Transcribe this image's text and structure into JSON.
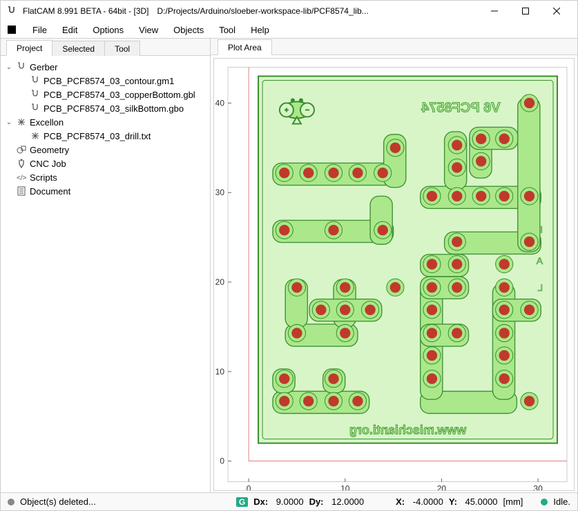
{
  "title": "FlatCAM 8.991 BETA - 64bit - [3D]",
  "filepath": "D:/Projects/Arduino/sloeber-workspace-lib/PCF8574_lib...",
  "menus": [
    "File",
    "Edit",
    "Options",
    "View",
    "Objects",
    "Tool",
    "Help"
  ],
  "left_tabs": [
    "Project",
    "Selected",
    "Tool"
  ],
  "left_active": 0,
  "right_tabs": [
    "Plot Area"
  ],
  "right_active": 0,
  "tree": [
    {
      "label": "Gerber",
      "icon": "gerber",
      "depth": 1,
      "expand": true,
      "children": [
        {
          "label": "PCB_PCF8574_03_contour.gm1",
          "icon": "gerber",
          "depth": 2
        },
        {
          "label": "PCB_PCF8574_03_copperBottom.gbl",
          "icon": "gerber",
          "depth": 2
        },
        {
          "label": "PCB_PCF8574_03_silkBottom.gbo",
          "icon": "gerber",
          "depth": 2
        }
      ]
    },
    {
      "label": "Excellon",
      "icon": "drill",
      "depth": 1,
      "expand": true,
      "children": [
        {
          "label": "PCB_PCF8574_03_drill.txt",
          "icon": "drill",
          "depth": 2
        }
      ]
    },
    {
      "label": "Geometry",
      "icon": "geom",
      "depth": 1
    },
    {
      "label": "CNC Job",
      "icon": "cnc",
      "depth": 1
    },
    {
      "label": "Scripts",
      "icon": "script",
      "depth": 1
    },
    {
      "label": "Document",
      "icon": "doc",
      "depth": 1
    }
  ],
  "status": {
    "left": "Object(s) deleted...",
    "dx_label": "Dx:",
    "dx": "9.0000",
    "dy_label": "Dy:",
    "dy": "12.0000",
    "x_label": "X:",
    "x": "-4.0000",
    "y_label": "Y:",
    "y": "45.0000",
    "unit": "[mm]",
    "idle": "Idle."
  },
  "axes": {
    "x_ticks": [
      "0",
      "10",
      "20",
      "30"
    ],
    "y_ticks": [
      "0",
      "10",
      "20",
      "30",
      "40"
    ]
  },
  "silk_top": "V6   PCF8574",
  "silk_bottom": "www.mischianti.org",
  "chart_data": {
    "type": "pcb-plot",
    "x_range": [
      0,
      33
    ],
    "y_range": [
      0,
      44
    ],
    "drills_mm": [
      [
        3.7,
        6.7
      ],
      [
        6.2,
        6.7
      ],
      [
        8.8,
        6.7
      ],
      [
        11.3,
        6.7
      ],
      [
        29.1,
        6.7
      ],
      [
        3.7,
        9.2
      ],
      [
        8.8,
        9.2
      ],
      [
        19.0,
        9.2
      ],
      [
        26.5,
        9.2
      ],
      [
        19.0,
        11.8
      ],
      [
        26.5,
        11.8
      ],
      [
        5.0,
        14.3
      ],
      [
        10.0,
        14.3
      ],
      [
        19.0,
        14.3
      ],
      [
        21.6,
        14.3
      ],
      [
        26.5,
        14.3
      ],
      [
        7.5,
        16.9
      ],
      [
        10.0,
        16.9
      ],
      [
        12.6,
        16.9
      ],
      [
        19.0,
        16.9
      ],
      [
        26.5,
        16.9
      ],
      [
        29.1,
        16.9
      ],
      [
        5.0,
        19.4
      ],
      [
        10.0,
        19.4
      ],
      [
        15.2,
        19.4
      ],
      [
        19.0,
        19.4
      ],
      [
        21.6,
        19.4
      ],
      [
        26.5,
        19.4
      ],
      [
        19.0,
        22.0
      ],
      [
        21.6,
        22.0
      ],
      [
        26.5,
        22.0
      ],
      [
        3.7,
        25.8
      ],
      [
        8.8,
        25.8
      ],
      [
        13.9,
        25.8
      ],
      [
        21.6,
        24.5
      ],
      [
        29.1,
        24.5
      ],
      [
        19.0,
        29.6
      ],
      [
        21.6,
        29.6
      ],
      [
        24.1,
        29.6
      ],
      [
        26.5,
        29.6
      ],
      [
        29.1,
        29.6
      ],
      [
        3.7,
        32.2
      ],
      [
        6.2,
        32.2
      ],
      [
        8.8,
        32.2
      ],
      [
        11.3,
        32.2
      ],
      [
        13.9,
        32.2
      ],
      [
        15.2,
        35.0
      ],
      [
        21.6,
        32.8
      ],
      [
        21.6,
        35.3
      ],
      [
        24.1,
        33.5
      ],
      [
        24.1,
        36.0
      ],
      [
        26.5,
        36.0
      ],
      [
        29.1,
        40.0
      ]
    ]
  }
}
